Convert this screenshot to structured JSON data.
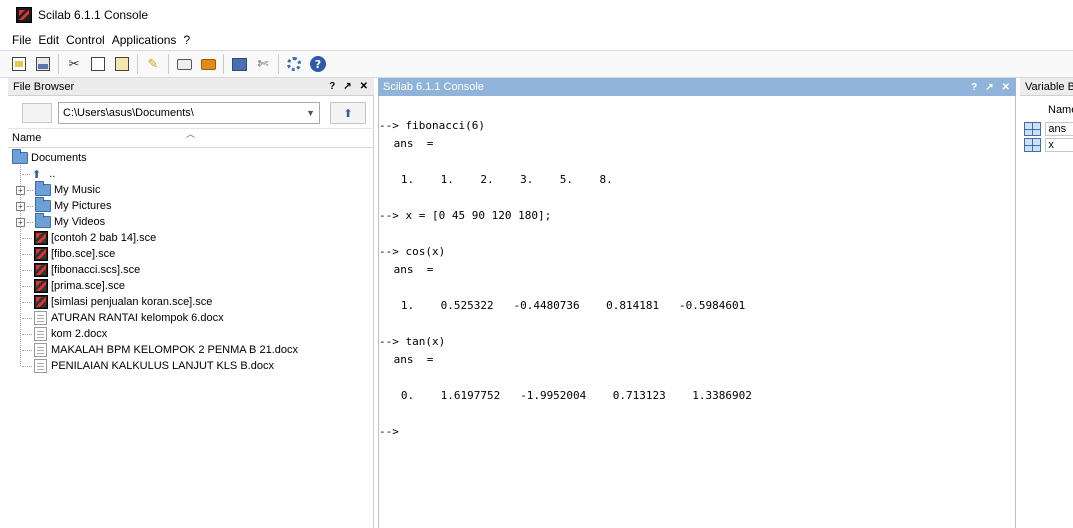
{
  "window": {
    "title": "Scilab 6.1.1 Console"
  },
  "menu": {
    "items": [
      "File",
      "Edit",
      "Control",
      "Applications",
      "?"
    ]
  },
  "toolbar": {
    "icons": [
      "new-script-icon",
      "open-file-icon",
      "cut-icon",
      "copy-icon",
      "paste-icon",
      "clear-console-icon",
      "print-icon",
      "module-manager-icon",
      "variable-browser-icon",
      "preferences-icon",
      "atoms-icon",
      "help-icon"
    ]
  },
  "file_browser": {
    "title": "File Browser",
    "controls": [
      "?",
      "↗",
      "✕"
    ],
    "path": "C:\\Users\\asus\\Documents\\",
    "column_name": "Name",
    "root": "Documents",
    "parent": "..",
    "items": [
      {
        "label": "My Music",
        "type": "folder"
      },
      {
        "label": "My Pictures",
        "type": "folder"
      },
      {
        "label": "My Videos",
        "type": "folder"
      },
      {
        "label": "[contoh 2 bab 14].sce",
        "type": "sce"
      },
      {
        "label": "[fibo.sce].sce",
        "type": "sce"
      },
      {
        "label": "[fibonacci.scs].sce",
        "type": "sce"
      },
      {
        "label": "[prima.sce].sce",
        "type": "sce"
      },
      {
        "label": "[simlasi penjualan koran.sce].sce",
        "type": "sce"
      },
      {
        "label": "ATURAN RANTAI kelompok 6.docx",
        "type": "docx"
      },
      {
        "label": "kom 2.docx",
        "type": "docx"
      },
      {
        "label": "MAKALAH BPM KELOMPOK 2 PENMA B 21.docx",
        "type": "docx"
      },
      {
        "label": "PENILAIAN KALKULUS LANJUT KLS B.docx",
        "type": "docx"
      }
    ]
  },
  "console": {
    "title": "Scilab 6.1.1 Console",
    "controls": [
      "?",
      "↗",
      "✕"
    ],
    "lines": [
      "--> fibonacci(6)",
      " ans  =",
      "   1.    1.    2.    3.    5.    8.",
      "--> x = [0 45 90 120 180];",
      "--> cos(x)",
      " ans  =",
      "   1.    0.525322   -0.4480736    0.814181   -0.5984601",
      "--> tan(x)",
      " ans  =",
      "   0.    1.6197752   -1.9952004    0.713123    1.3386902",
      "-->"
    ]
  },
  "variable_browser": {
    "title": "Variable B",
    "column_name": "Name",
    "variables": [
      "ans",
      "x"
    ]
  }
}
